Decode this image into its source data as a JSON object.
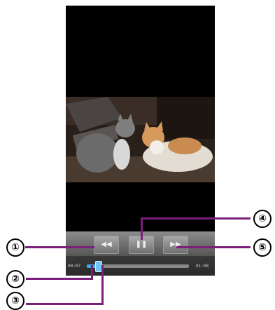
{
  "player": {
    "controls": {
      "rewind_icon": "rewind-icon",
      "pause_icon": "pause-icon",
      "fast_forward_icon": "fast-forward-icon",
      "elapsed_time": "00:07",
      "total_time": "01:08",
      "progress_fraction": 0.1
    }
  },
  "callouts": [
    "①",
    "②",
    "③",
    "④",
    "⑤"
  ],
  "colors": {
    "callout_line": "#7a1f7a",
    "seek_fill": "#39a9e8"
  }
}
